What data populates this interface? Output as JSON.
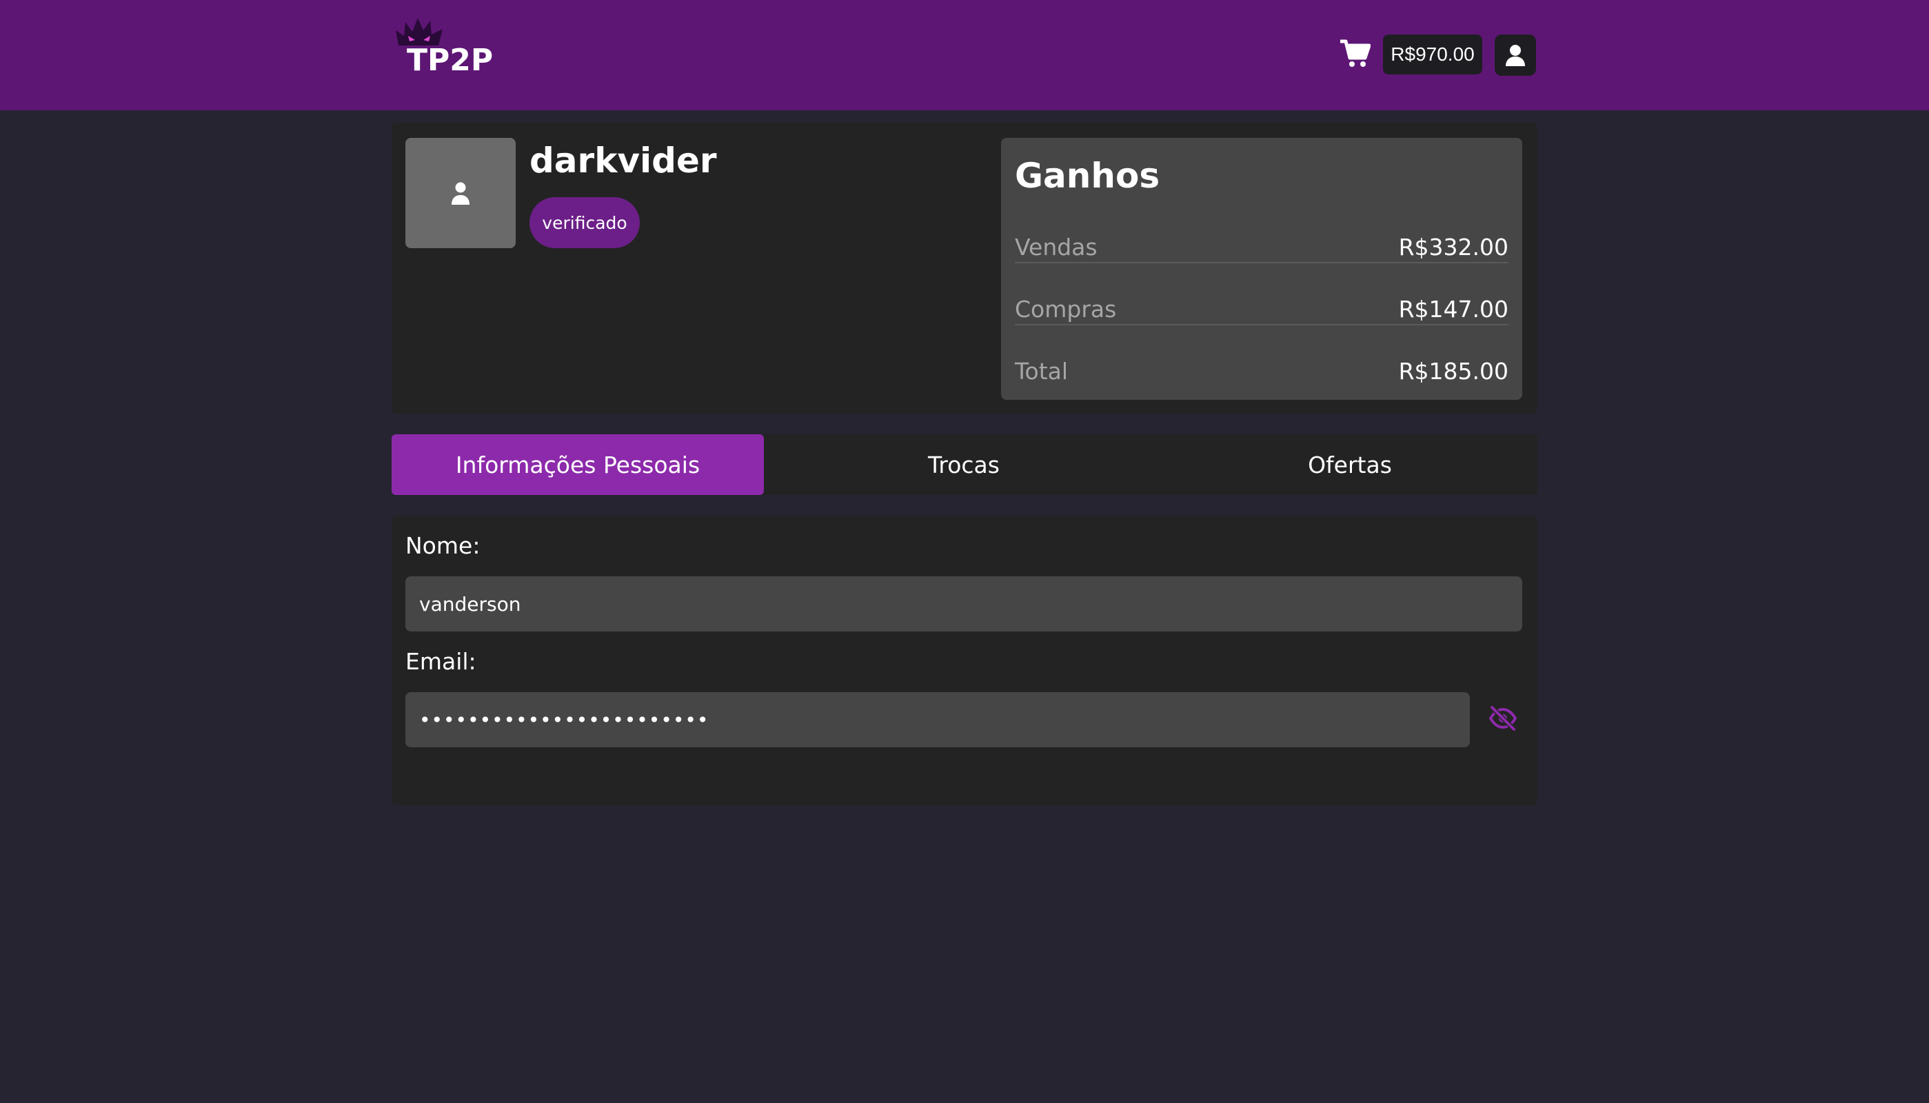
{
  "header": {
    "logo_text": "TP2P",
    "balance": "R$970.00",
    "cart_icon": "cart-icon",
    "user_icon": "user-icon",
    "brand_color": "#5e1675"
  },
  "profile": {
    "username": "darkvider",
    "badge": "verificado",
    "avatar_icon": "user-icon"
  },
  "earnings": {
    "title": "Ganhos",
    "rows": [
      {
        "label": "Vendas",
        "value": "R$332.00"
      },
      {
        "label": "Compras",
        "value": "R$147.00"
      },
      {
        "label": "Total",
        "value": "R$185.00"
      }
    ]
  },
  "tabs": [
    {
      "label": "Informações Pessoais",
      "active": true
    },
    {
      "label": "Trocas",
      "active": false
    },
    {
      "label": "Ofertas",
      "active": false
    }
  ],
  "form": {
    "name_label": "Nome:",
    "name_value": "vanderson",
    "email_label": "Email:",
    "email_value": "••••••••••••••••••••••••",
    "visibility_icon": "eye-slash-icon",
    "accent_color": "#8d2aab"
  }
}
